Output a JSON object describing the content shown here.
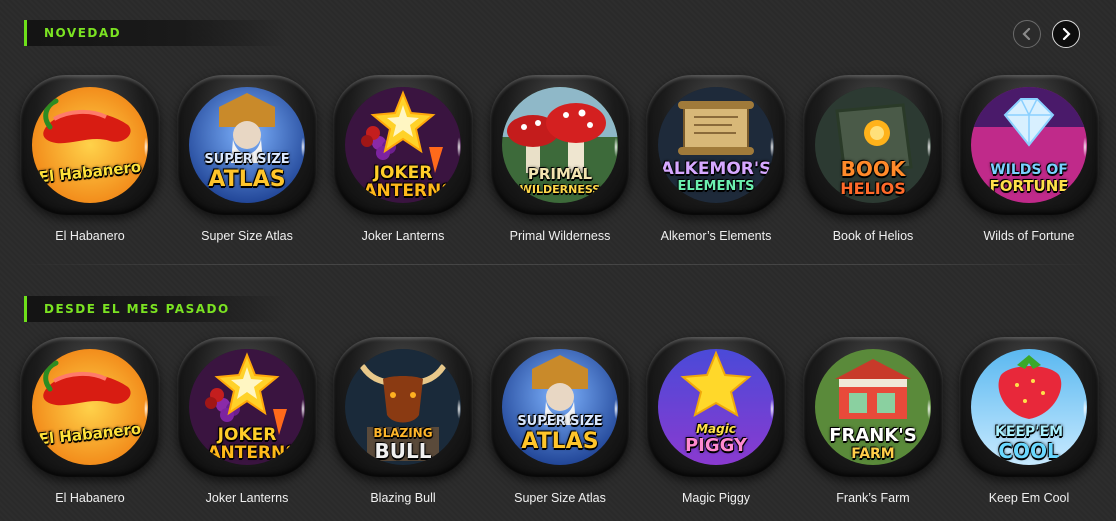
{
  "sections": [
    {
      "title": "NOVEDAD",
      "nav": {
        "prev_icon": "chevron-left-icon",
        "next_icon": "chevron-right-icon"
      },
      "games": [
        {
          "name": "El Habanero",
          "logo": "El Habanero"
        },
        {
          "name": "Super Size Atlas",
          "logo_top": "SUPER SIZE",
          "logo_bottom": "ATLAS"
        },
        {
          "name": "Joker Lanterns",
          "logo_top": "JOKER",
          "logo_bottom": "LANTERNS"
        },
        {
          "name": "Primal Wilderness",
          "logo_top": "PRIMAL",
          "logo_bottom": "WILDERNESS"
        },
        {
          "name": "Alkemor’s Elements",
          "logo_top": "ALKEMOR'S",
          "logo_bottom": "ELEMENTS"
        },
        {
          "name": "Book of Helios",
          "logo_top": "BOOK",
          "logo_bottom": "HELIOS"
        },
        {
          "name": "Wilds of Fortune",
          "logo_top": "WILDS OF",
          "logo_bottom": "FORTUNE"
        }
      ]
    },
    {
      "title": "DESDE EL MES PASADO",
      "games": [
        {
          "name": "El Habanero",
          "logo": "El Habanero"
        },
        {
          "name": "Joker Lanterns",
          "logo_top": "JOKER",
          "logo_bottom": "LANTERNS"
        },
        {
          "name": "Blazing Bull",
          "logo_top": "BLAZING",
          "logo_bottom": "BULL"
        },
        {
          "name": "Super Size Atlas",
          "logo_top": "SUPER SIZE",
          "logo_bottom": "ATLAS"
        },
        {
          "name": "Magic Piggy",
          "logo_top": "Magic",
          "logo_bottom": "PIGGY"
        },
        {
          "name": "Frank’s Farm",
          "logo_top": "FRANK'S",
          "logo_bottom": "FARM"
        },
        {
          "name": "Keep Em Cool",
          "logo_top": "KEEP'EM",
          "logo_bottom": "COOL"
        }
      ]
    }
  ],
  "colors": {
    "accent_green": "#7be322",
    "background": "#2a2a2a"
  }
}
